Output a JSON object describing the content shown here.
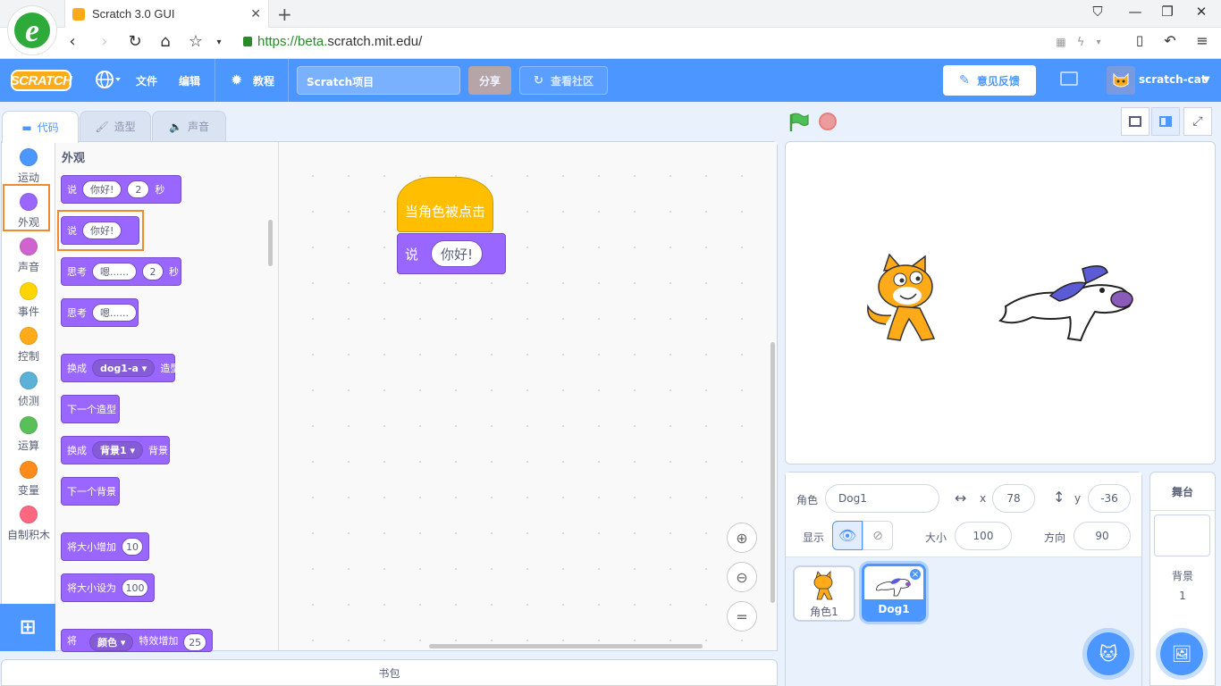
{
  "browser": {
    "tab_title": "Scratch 3.0 GUI",
    "url_scheme": "https://beta.",
    "url_domain": "scratch.mit.edu",
    "url_path": "/"
  },
  "menubar": {
    "logo": "SCRATCH",
    "file": "文件",
    "edit": "编辑",
    "tutorials": "教程",
    "project_title": "Scratch项目",
    "share": "分享",
    "see_community": "查看社区",
    "feedback": "意见反馈",
    "username": "scratch-cat"
  },
  "tabs": {
    "code": "代码",
    "costumes": "造型",
    "sounds": "声音"
  },
  "categories": [
    {
      "label": "运动",
      "color": "#4c97ff"
    },
    {
      "label": "外观",
      "color": "#9966ff"
    },
    {
      "label": "声音",
      "color": "#cf63cf"
    },
    {
      "label": "事件",
      "color": "#ffd500"
    },
    {
      "label": "控制",
      "color": "#ffab19"
    },
    {
      "label": "侦测",
      "color": "#5cb1d6"
    },
    {
      "label": "运算",
      "color": "#59c059"
    },
    {
      "label": "变量",
      "color": "#ff8c1a"
    },
    {
      "label": "自制积木",
      "color": "#ff6680"
    }
  ],
  "palette": {
    "title": "外观",
    "blocks": {
      "say_for": {
        "say": "说",
        "msg": "你好!",
        "secs": "2",
        "unit": "秒"
      },
      "say": {
        "say": "说",
        "msg": "你好!"
      },
      "think_for": {
        "think": "思考",
        "msg": "嗯......",
        "secs": "2",
        "unit": "秒"
      },
      "think": {
        "think": "思考",
        "msg": "嗯......"
      },
      "switch_costume": {
        "pre": "换成",
        "value": "dog1-a",
        "post": "造型"
      },
      "next_costume": "下一个造型",
      "switch_backdrop": {
        "pre": "换成",
        "value": "背景1",
        "post": "背景"
      },
      "next_backdrop": "下一个背景",
      "change_size": {
        "label": "将大小增加",
        "value": "10"
      },
      "set_size": {
        "label": "将大小设为",
        "value": "100"
      },
      "change_effect": {
        "pre": "将",
        "value": "颜色",
        "mid": "特效增加",
        "num": "25"
      }
    }
  },
  "script": {
    "hat": "当角色被点击",
    "say": "说",
    "msg": "你好!"
  },
  "backpack": "书包",
  "sprite_info": {
    "sprite_label": "角色",
    "sprite_name": "Dog1",
    "x_label": "x",
    "x": "78",
    "y_label": "y",
    "y": "-36",
    "show_label": "显示",
    "size_label": "大小",
    "size": "100",
    "direction_label": "方向",
    "direction": "90"
  },
  "sprites": [
    {
      "name": "角色1",
      "selected": false
    },
    {
      "name": "Dog1",
      "selected": true
    }
  ],
  "stage_panel": {
    "title": "舞台",
    "backdrops_label": "背景",
    "backdrops_count": "1"
  }
}
